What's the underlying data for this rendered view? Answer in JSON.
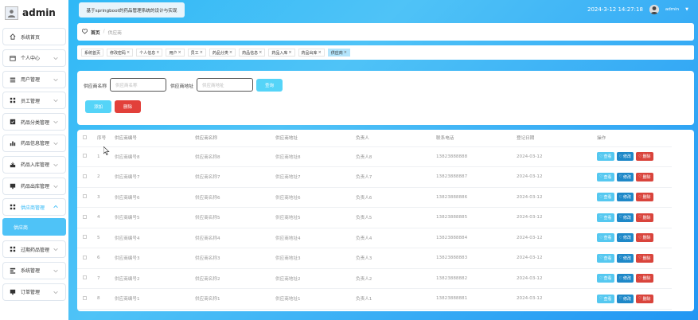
{
  "brand": {
    "name": "admin"
  },
  "header": {
    "title": "基于springboot的药品管理系统的设计与实现",
    "datetime": "2024-3-12 14:27:18",
    "user": "admin"
  },
  "sidebar": {
    "items": [
      {
        "label": "系统首页",
        "icon": "home-icon"
      },
      {
        "label": "个人中心",
        "icon": "calendar-icon"
      },
      {
        "label": "用户管理",
        "icon": "list-icon"
      },
      {
        "label": "员工管理",
        "icon": "grid-icon"
      },
      {
        "label": "药品分类管理",
        "icon": "check-square-icon"
      },
      {
        "label": "药品信息管理",
        "icon": "bar-chart-icon"
      },
      {
        "label": "药品入库管理",
        "icon": "import-icon"
      },
      {
        "label": "药品出库管理",
        "icon": "monitor-icon"
      },
      {
        "label": "供应商管理",
        "icon": "grid-icon"
      },
      {
        "label": "过期药品管理",
        "icon": "grid-icon"
      },
      {
        "label": "系统管理",
        "icon": "settings-icon"
      },
      {
        "label": "订单管理",
        "icon": "monitor-icon"
      }
    ],
    "active_sub": "供应商"
  },
  "breadcrumb": {
    "home": "首页",
    "current": "供应商"
  },
  "tags": [
    {
      "label": "系统首页",
      "closable": false
    },
    {
      "label": "修改密码",
      "closable": true
    },
    {
      "label": "个人信息",
      "closable": true
    },
    {
      "label": "用户",
      "closable": true
    },
    {
      "label": "员工",
      "closable": true
    },
    {
      "label": "药品分类",
      "closable": true
    },
    {
      "label": "药品信息",
      "closable": true
    },
    {
      "label": "药品入库",
      "closable": true
    },
    {
      "label": "药品出库",
      "closable": true
    },
    {
      "label": "供应商",
      "closable": true,
      "active": true
    }
  ],
  "search": {
    "name_label": "供应商名称",
    "name_placeholder": "供应商名称",
    "addr_label": "供应商地址",
    "addr_placeholder": "供应商地址",
    "query_btn": "查询",
    "add_btn": "添加",
    "delete_btn": "删除"
  },
  "table": {
    "columns": [
      "序号",
      "供应商编号",
      "供应商名称",
      "供应商地址",
      "负责人",
      "联系电话",
      "登记日期",
      "操作"
    ],
    "rows": [
      [
        "1",
        "供应商编号8",
        "供应商名称8",
        "供应商地址8",
        "负责人8",
        "13823888888",
        "2024-03-12"
      ],
      [
        "2",
        "供应商编号7",
        "供应商名称7",
        "供应商地址7",
        "负责人7",
        "13823888887",
        "2024-03-12"
      ],
      [
        "3",
        "供应商编号6",
        "供应商名称6",
        "供应商地址6",
        "负责人6",
        "13823888886",
        "2024-03-12"
      ],
      [
        "4",
        "供应商编号5",
        "供应商名称5",
        "供应商地址5",
        "负责人5",
        "13823888885",
        "2024-03-12"
      ],
      [
        "5",
        "供应商编号4",
        "供应商名称4",
        "供应商地址4",
        "负责人4",
        "13823888884",
        "2024-03-12"
      ],
      [
        "6",
        "供应商编号3",
        "供应商名称3",
        "供应商地址3",
        "负责人3",
        "13823888883",
        "2024-03-12"
      ],
      [
        "7",
        "供应商编号2",
        "供应商名称2",
        "供应商地址2",
        "负责人2",
        "13823888882",
        "2024-03-12"
      ],
      [
        "8",
        "供应商编号1",
        "供应商名称1",
        "供应商地址1",
        "负责人1",
        "13823888881",
        "2024-03-12"
      ]
    ],
    "actions": {
      "view": "查看",
      "edit": "修改",
      "delete": "删除"
    }
  }
}
